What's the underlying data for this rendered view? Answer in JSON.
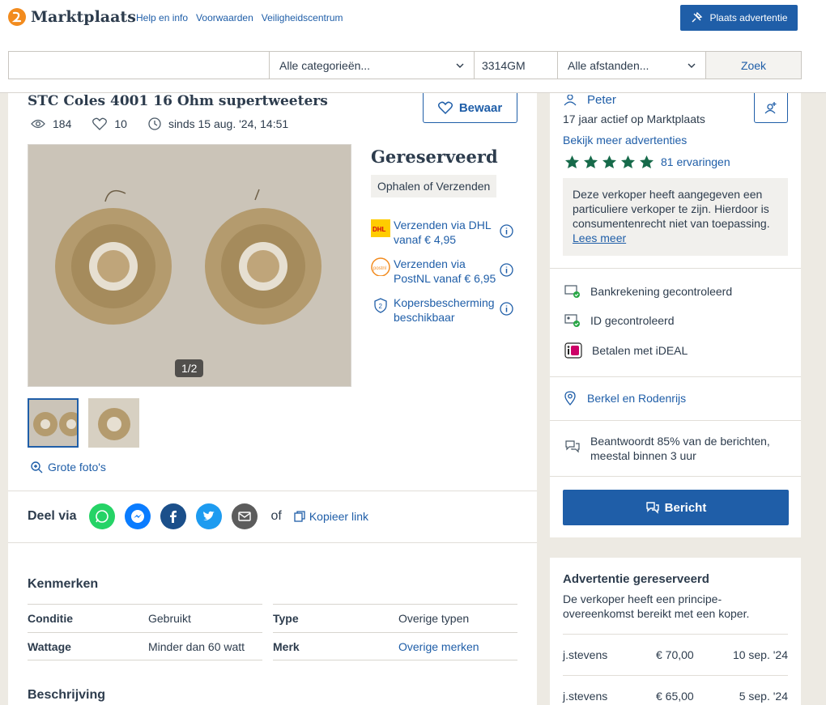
{
  "header": {
    "brand": "Marktplaats",
    "links": [
      "Help en info",
      "Voorwaarden",
      "Veiligheidscentrum"
    ],
    "place_ad_label": "Plaats advertentie",
    "search": {
      "query": "",
      "category": "Alle categorieën...",
      "postcode": "3314GM",
      "distance": "Alle afstanden...",
      "button": "Zoek"
    }
  },
  "listing": {
    "title": "STC Coles 4001 16 Ohm supertweeters",
    "views": "184",
    "favorites": "10",
    "since": "sinds 15 aug. '24, 14:51",
    "save_label": "Bewaar",
    "photo_counter": "1/2",
    "photos_link": "Grote foto's",
    "status": "Gereserveerd",
    "delivery": "Ophalen of Verzenden",
    "shipping": [
      {
        "line1": "Verzenden via DHL",
        "line2": "vanaf € 4,95"
      },
      {
        "line1": "Verzenden via",
        "line2": "PostNL vanaf € 6,95"
      },
      {
        "line1": "Kopersbescherming",
        "line2": "beschikbaar"
      }
    ],
    "share_label": "Deel via",
    "share_or": "of",
    "copy_link": "Kopieer link",
    "characteristics_title": "Kenmerken",
    "characteristics": [
      {
        "name": "Conditie",
        "value": "Gebruikt"
      },
      {
        "name": "Type",
        "value": "Overige typen"
      },
      {
        "name": "Wattage",
        "value": "Minder dan 60 watt"
      },
      {
        "name": "Merk",
        "value": "Overige merken"
      }
    ],
    "description_title": "Beschrijving"
  },
  "seller": {
    "name": "Peter",
    "active_since": "17 jaar actief op Marktplaats",
    "more_ads": "Bekijk meer advertenties",
    "rating_stars": 5,
    "reviews": "81 ervaringen",
    "note": "Deze verkoper heeft aangegeven een particuliere verkoper te zijn. Hierdoor is consumentenrecht niet van toepassing.",
    "note_link": "Lees meer",
    "verifications": [
      "Bankrekening gecontroleerd",
      "ID gecontroleerd",
      "Betalen met iDEAL"
    ],
    "location": "Berkel en Rodenrijs",
    "response_line1": "Beantwoordt 85% van de berichten,",
    "response_line2": "meestal binnen 3 uur",
    "message_label": "Bericht"
  },
  "reserved": {
    "title": "Advertentie gereserveerd",
    "subtitle": "De verkoper heeft een principe-overeenkomst bereikt met een koper.",
    "bids": [
      {
        "user": "j.stevens",
        "amount": "€ 70,00",
        "date": "10 sep. '24"
      },
      {
        "user": "j.stevens",
        "amount": "€ 65,00",
        "date": "5 sep. '24"
      }
    ]
  },
  "colors": {
    "brand_blue": "#1f5ea8",
    "logo_orange": "#f28b1e",
    "star_green": "#166a4a"
  }
}
